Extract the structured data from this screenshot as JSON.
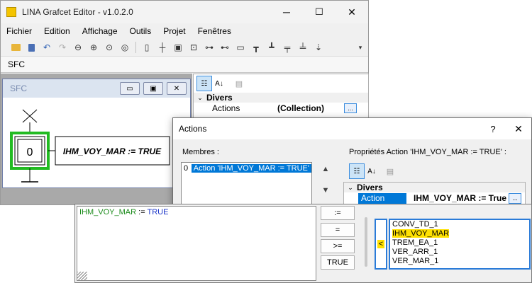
{
  "app": {
    "title": "LINA Grafcet Editor - v1.0.2.0",
    "menu": [
      "Fichier",
      "Edition",
      "Affichage",
      "Outils",
      "Projet",
      "Fenêtres"
    ],
    "toolbar_icons": [
      "open-folder-icon",
      "delete-icon",
      "undo-icon",
      "redo-icon",
      "zoom-out-icon",
      "zoom-in-icon",
      "zoom-fit-icon",
      "zoom-search-icon",
      "step-icon",
      "transition-icon",
      "initial-step-icon",
      "macro-step-icon",
      "action-icon",
      "receptivity-icon",
      "label-icon",
      "divergence-or-icon",
      "convergence-or-icon",
      "divergence-and-icon",
      "convergence-and-icon",
      "jump-icon"
    ],
    "second_toolbar_label": "SFC"
  },
  "sfc_window": {
    "title": "SFC",
    "step_number": "0",
    "action_text": "IHM_VOY_MAR := TRUE"
  },
  "property_grid": {
    "category": "Divers",
    "prop_name": "Actions",
    "prop_value": "(Collection)",
    "ellipsis": "..."
  },
  "dialog": {
    "title": "Actions",
    "help": "?",
    "close": "✕",
    "members_label": "Membres :",
    "members": [
      {
        "index": "0",
        "text": "Action 'IHM_VOY_MAR := TRUE'"
      }
    ],
    "props_label": "Propriétés Action 'IHM_VOY_MAR := TRUE' :",
    "category": "Divers",
    "prop_name": "Action",
    "prop_value": "IHM_VOY_MAR := True",
    "ellipsis": "..."
  },
  "editor": {
    "text_var": "IHM_VOY_MAR",
    "text_op": " := ",
    "text_val": "TRUE",
    "buttons": [
      ":=",
      "=",
      ">=",
      "TRUE"
    ],
    "insert_button": "<",
    "variables": [
      "CONV_TD_1",
      "IHM_VOY_MAR",
      "TREM_EA_1",
      "VER_ARR_1",
      "VER_MAR_1"
    ],
    "highlighted_variable": "IHM_VOY_MAR"
  }
}
